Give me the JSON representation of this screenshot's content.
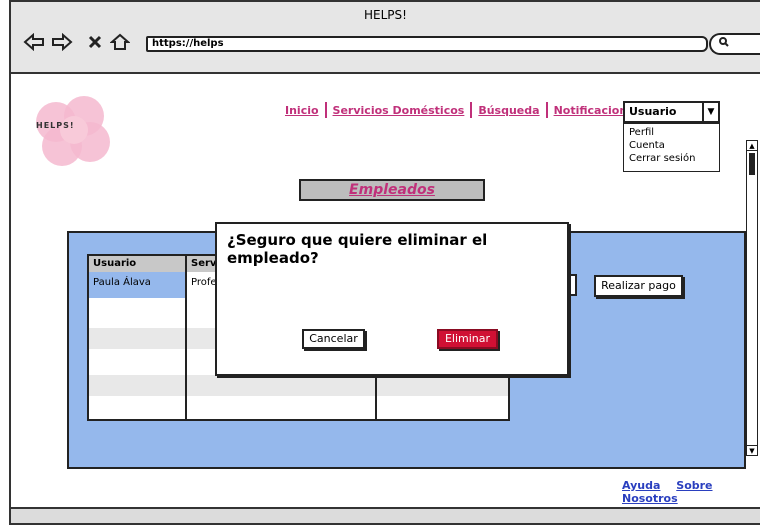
{
  "window": {
    "title": "HELPS!"
  },
  "browser": {
    "url": "https://helps",
    "search_icon": "search-icon"
  },
  "logo": {
    "text": "HELPS!",
    "color": "#f4b8cf"
  },
  "nav": {
    "items": [
      "Inicio",
      "Servicios Domésticos",
      "Búsqueda",
      "Notificaciones"
    ],
    "color": "#c0307a"
  },
  "user_menu": {
    "selected": "Usuario",
    "options": [
      "Perfil",
      "Cuenta",
      "Cerrar sesión"
    ]
  },
  "page": {
    "heading": "Empleados"
  },
  "table": {
    "columns": [
      "Usuario",
      "Servic"
    ],
    "rows": [
      [
        "Paula Álava",
        "Profe"
      ]
    ]
  },
  "actions": {
    "pay_label": "Realizar pago"
  },
  "modal": {
    "title": "¿Seguro que quiere eliminar el empleado?",
    "cancel_label": "Cancelar",
    "delete_label": "Eliminar",
    "delete_color": "#d01034"
  },
  "footer": {
    "links": [
      "Ayuda",
      "Sobre Nosotros"
    ]
  },
  "colors": {
    "panel": "#95b8ec",
    "accent": "#c0307a",
    "link": "#2a3fbf"
  }
}
